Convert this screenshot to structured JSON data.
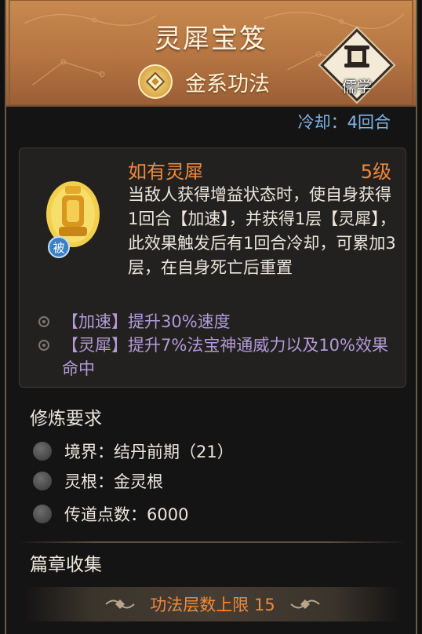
{
  "header": {
    "title": "灵犀宝笈",
    "type_label": "金系功法",
    "school_label": "儒学"
  },
  "cooldown": "冷却：4回合",
  "skill": {
    "name": "如有灵犀",
    "level": "5级",
    "passive_tag": "被",
    "description": "当敌人获得增益状态时，使自身获得1回合【加速】，并获得1层【灵犀】，此效果触发后有1回合冷却，可累加3层，在自身死亡后重置",
    "effects": [
      "【加速】提升30%速度",
      "【灵犀】提升7%法宝神通威力以及10%效果命中"
    ]
  },
  "requirements": {
    "title": "修炼要求",
    "items": [
      "境界：结丹前期（21）",
      "灵根：金灵根",
      "传道点数：6000"
    ]
  },
  "collection": {
    "title": "篇章收集",
    "limit_label": "功法层数上限 15"
  },
  "colors": {
    "header_bg": "#b57442",
    "skill_name": "#f08a3c",
    "cooldown": "#7fb4e6",
    "effect_text": "#b39ad8"
  }
}
